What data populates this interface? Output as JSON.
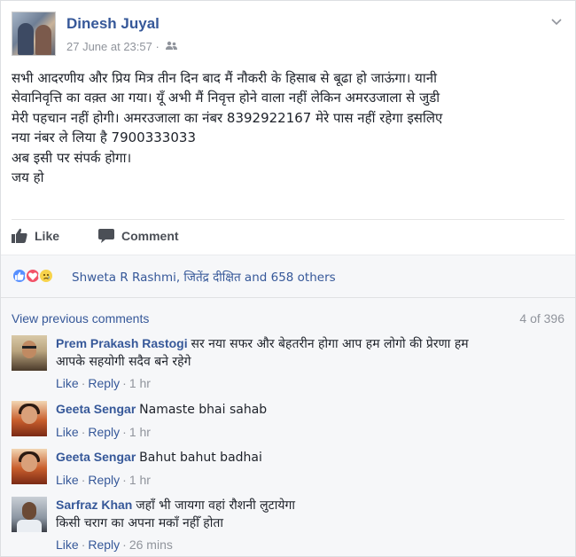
{
  "post": {
    "author": "Dinesh Juyal",
    "timestamp": "27 June at 23:57",
    "separator": "·",
    "audience_icon": "friends-icon",
    "body_lines": [
      "सभी आदरणीय और प्रिय मित्र तीन दिन बाद मैं नौकरी के हिसाब से बूढा हो जाऊंगा। यानी",
      "सेवानिवृत्ति का वक़्त आ गया। यूँ अभी मैं निवृत्त होने वाला नहीं लेकिन अमरउजाला से जुडी",
      "मेरी पहचान नहीं होगी। अमरउजाला का नंबर 8392922167 मेरे पास नहीं रहेगा इसलिए",
      "नया नंबर ले लिया है 7900333033",
      "अब इसी पर संपर्क होगा।",
      "जय हो"
    ]
  },
  "actions": {
    "like_label": "Like",
    "comment_label": "Comment"
  },
  "reactions": {
    "summary": "Shweta R Rashmi, जितेंद्र दीक्षित and 658 others",
    "colors": {
      "like": "#5890ff",
      "love": "#f25268",
      "sad": "#f7d34b"
    }
  },
  "comments_section": {
    "view_previous": "View previous comments",
    "count": "4 of 396",
    "like_label": "Like",
    "reply_label": "Reply",
    "separator": "·",
    "items": [
      {
        "name": "Prem Prakash Rastogi",
        "text_line1": "सर नया सफर और बेहतरीन होगा आप हम लोगो की प्रेरणा हम",
        "text_line2": "आपके सहयोगी सदैव बने रहेगे",
        "time": "1 hr"
      },
      {
        "name": "Geeta Sengar",
        "text_line1": "Namaste bhai sahab",
        "time": "1 hr"
      },
      {
        "name": "Geeta Sengar",
        "text_line1": "Bahut bahut badhai",
        "time": "1 hr"
      },
      {
        "name": "Sarfraz Khan",
        "text_line1": "जहाँ भी जायगा वहां रौशनी लुटायेगा",
        "text_line2": "किसी चराग का अपना मकाँ नहीँ होता",
        "time": "26 mins"
      }
    ]
  },
  "theme": {
    "link_color": "#365899",
    "muted_color": "#90949c",
    "text_color": "#1d2129"
  }
}
